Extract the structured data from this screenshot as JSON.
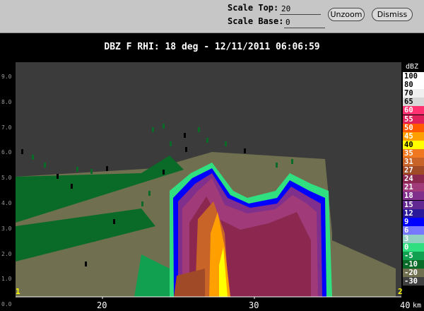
{
  "toolbar": {
    "scale_top_label": "Scale Top:",
    "scale_top_value": "20",
    "scale_base_label": "Scale Base:",
    "scale_base_value": "0",
    "unzoom_label": "Unzoom",
    "dismiss_label": "Dismiss"
  },
  "plot": {
    "title": "DBZ F  RHI: 18 deg  -  12/11/2011 06:06:59",
    "unit": "dBZ",
    "x_unit": "km",
    "corner_left": "1",
    "corner_right": "2",
    "y_ticks": [
      "9.0",
      "8.0",
      "7.0",
      "6.0",
      "5.0",
      "4.0",
      "3.0",
      "2.0",
      "1.0",
      "0.0"
    ],
    "x_ticks": [
      "20",
      "30",
      "40"
    ],
    "scale": [
      {
        "label": "100",
        "color": "#ffffff",
        "text": "#000000"
      },
      {
        "label": "80",
        "color": "#ffffff",
        "text": "#000000"
      },
      {
        "label": "70",
        "color": "#f0f0f0",
        "text": "#000000"
      },
      {
        "label": "65",
        "color": "#d8d8d8",
        "text": "#000000"
      },
      {
        "label": "60",
        "color": "#ff3070",
        "text": "#ffffff"
      },
      {
        "label": "55",
        "color": "#e0205a",
        "text": "#ffffff"
      },
      {
        "label": "50",
        "color": "#ff5a00",
        "text": "#ffffff"
      },
      {
        "label": "45",
        "color": "#ffa000",
        "text": "#ffffff"
      },
      {
        "label": "40",
        "color": "#ffff00",
        "text": "#000000"
      },
      {
        "label": "35",
        "color": "#f07820",
        "text": "#ffffff"
      },
      {
        "label": "31",
        "color": "#c86428",
        "text": "#ffffff"
      },
      {
        "label": "27",
        "color": "#a04a28",
        "text": "#ffffff"
      },
      {
        "label": "24",
        "color": "#8c2850",
        "text": "#ffffff"
      },
      {
        "label": "21",
        "color": "#a03a78",
        "text": "#ffffff"
      },
      {
        "label": "18",
        "color": "#80308c",
        "text": "#ffffff"
      },
      {
        "label": "15",
        "color": "#602890",
        "text": "#ffffff"
      },
      {
        "label": "12",
        "color": "#2a1a9a",
        "text": "#ffffff"
      },
      {
        "label": "9",
        "color": "#0000ff",
        "text": "#ffffff"
      },
      {
        "label": "6",
        "color": "#7878ff",
        "text": "#ffffff"
      },
      {
        "label": "3",
        "color": "#90d0c0",
        "text": "#ffffff"
      },
      {
        "label": "0",
        "color": "#30e080",
        "text": "#ffffff"
      },
      {
        "label": "-5",
        "color": "#10a050",
        "text": "#ffffff"
      },
      {
        "label": "-10",
        "color": "#0a6a28",
        "text": "#ffffff"
      },
      {
        "label": "-20",
        "color": "#707050",
        "text": "#ffffff"
      },
      {
        "label": "-30",
        "color": "#404040",
        "text": "#ffffff"
      }
    ]
  },
  "colors": {
    "background": "#3b3b3b",
    "toolbar": "#c6c6c6"
  }
}
